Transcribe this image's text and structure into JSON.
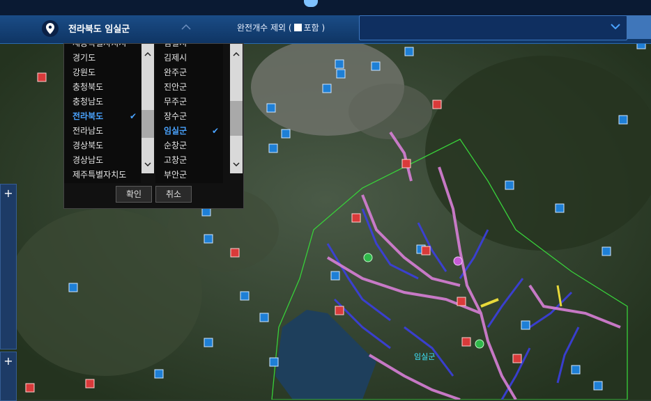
{
  "toolbar": {
    "location_label": "전라북도 임실군",
    "exclude_label": "완전개수 제외 (",
    "include_label": "포함 )",
    "search_value": ""
  },
  "regions": {
    "provinces": [
      "세종특별자치시",
      "경기도",
      "강원도",
      "충청북도",
      "충청남도",
      "전라북도",
      "전라남도",
      "경상북도",
      "경상남도",
      "제주특별자치도"
    ],
    "selected_province": "전라북도",
    "counties": [
      "임실시",
      "김제시",
      "완주군",
      "진안군",
      "무주군",
      "장수군",
      "임실군",
      "순창군",
      "고창군",
      "부안군"
    ],
    "selected_county": "임실군",
    "confirm_label": "확인",
    "cancel_label": "취소"
  },
  "map": {
    "area_label": "임실군",
    "colors": {
      "water": "#1e3f5c",
      "river": "#d77fd6",
      "tributary": "#3b3fe0",
      "boundary": "#38d03a",
      "highlight_river": "#e8d93a",
      "marker_blue": "#1e7fd6",
      "marker_red": "#d93a3a"
    }
  }
}
